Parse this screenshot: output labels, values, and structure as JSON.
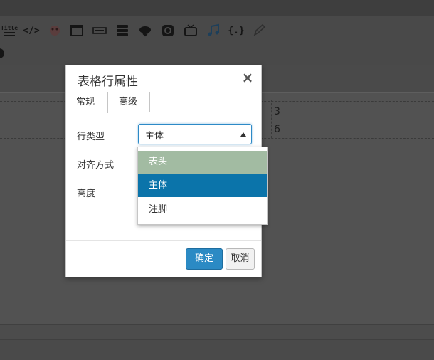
{
  "toolbar": {
    "title_icon_text": "Title",
    "code_icon_text": "</>",
    "braces_icon_text": "{.}"
  },
  "table_cells": {
    "row1_value": "3",
    "row2_value": "6"
  },
  "dialog": {
    "title": "表格行属性",
    "close_glyph": "×",
    "tabs": [
      {
        "label": "常规",
        "active": true
      },
      {
        "label": "高级",
        "active": false
      }
    ],
    "fields": {
      "row_type_label": "行类型",
      "row_type_value": "主体",
      "align_label": "对齐方式",
      "height_label": "高度"
    },
    "buttons": {
      "ok_label": "确定",
      "cancel_label": "取消"
    }
  },
  "dropdown": {
    "options": [
      {
        "label": "表头",
        "state": "hover"
      },
      {
        "label": "主体",
        "state": "selected"
      },
      {
        "label": "注脚",
        "state": "normal"
      }
    ]
  },
  "colors": {
    "primary": "#2b8ac4",
    "selected_option": "#0b74aa",
    "hover_option": "#a2bba2",
    "overlay": "#4a4a4a"
  }
}
